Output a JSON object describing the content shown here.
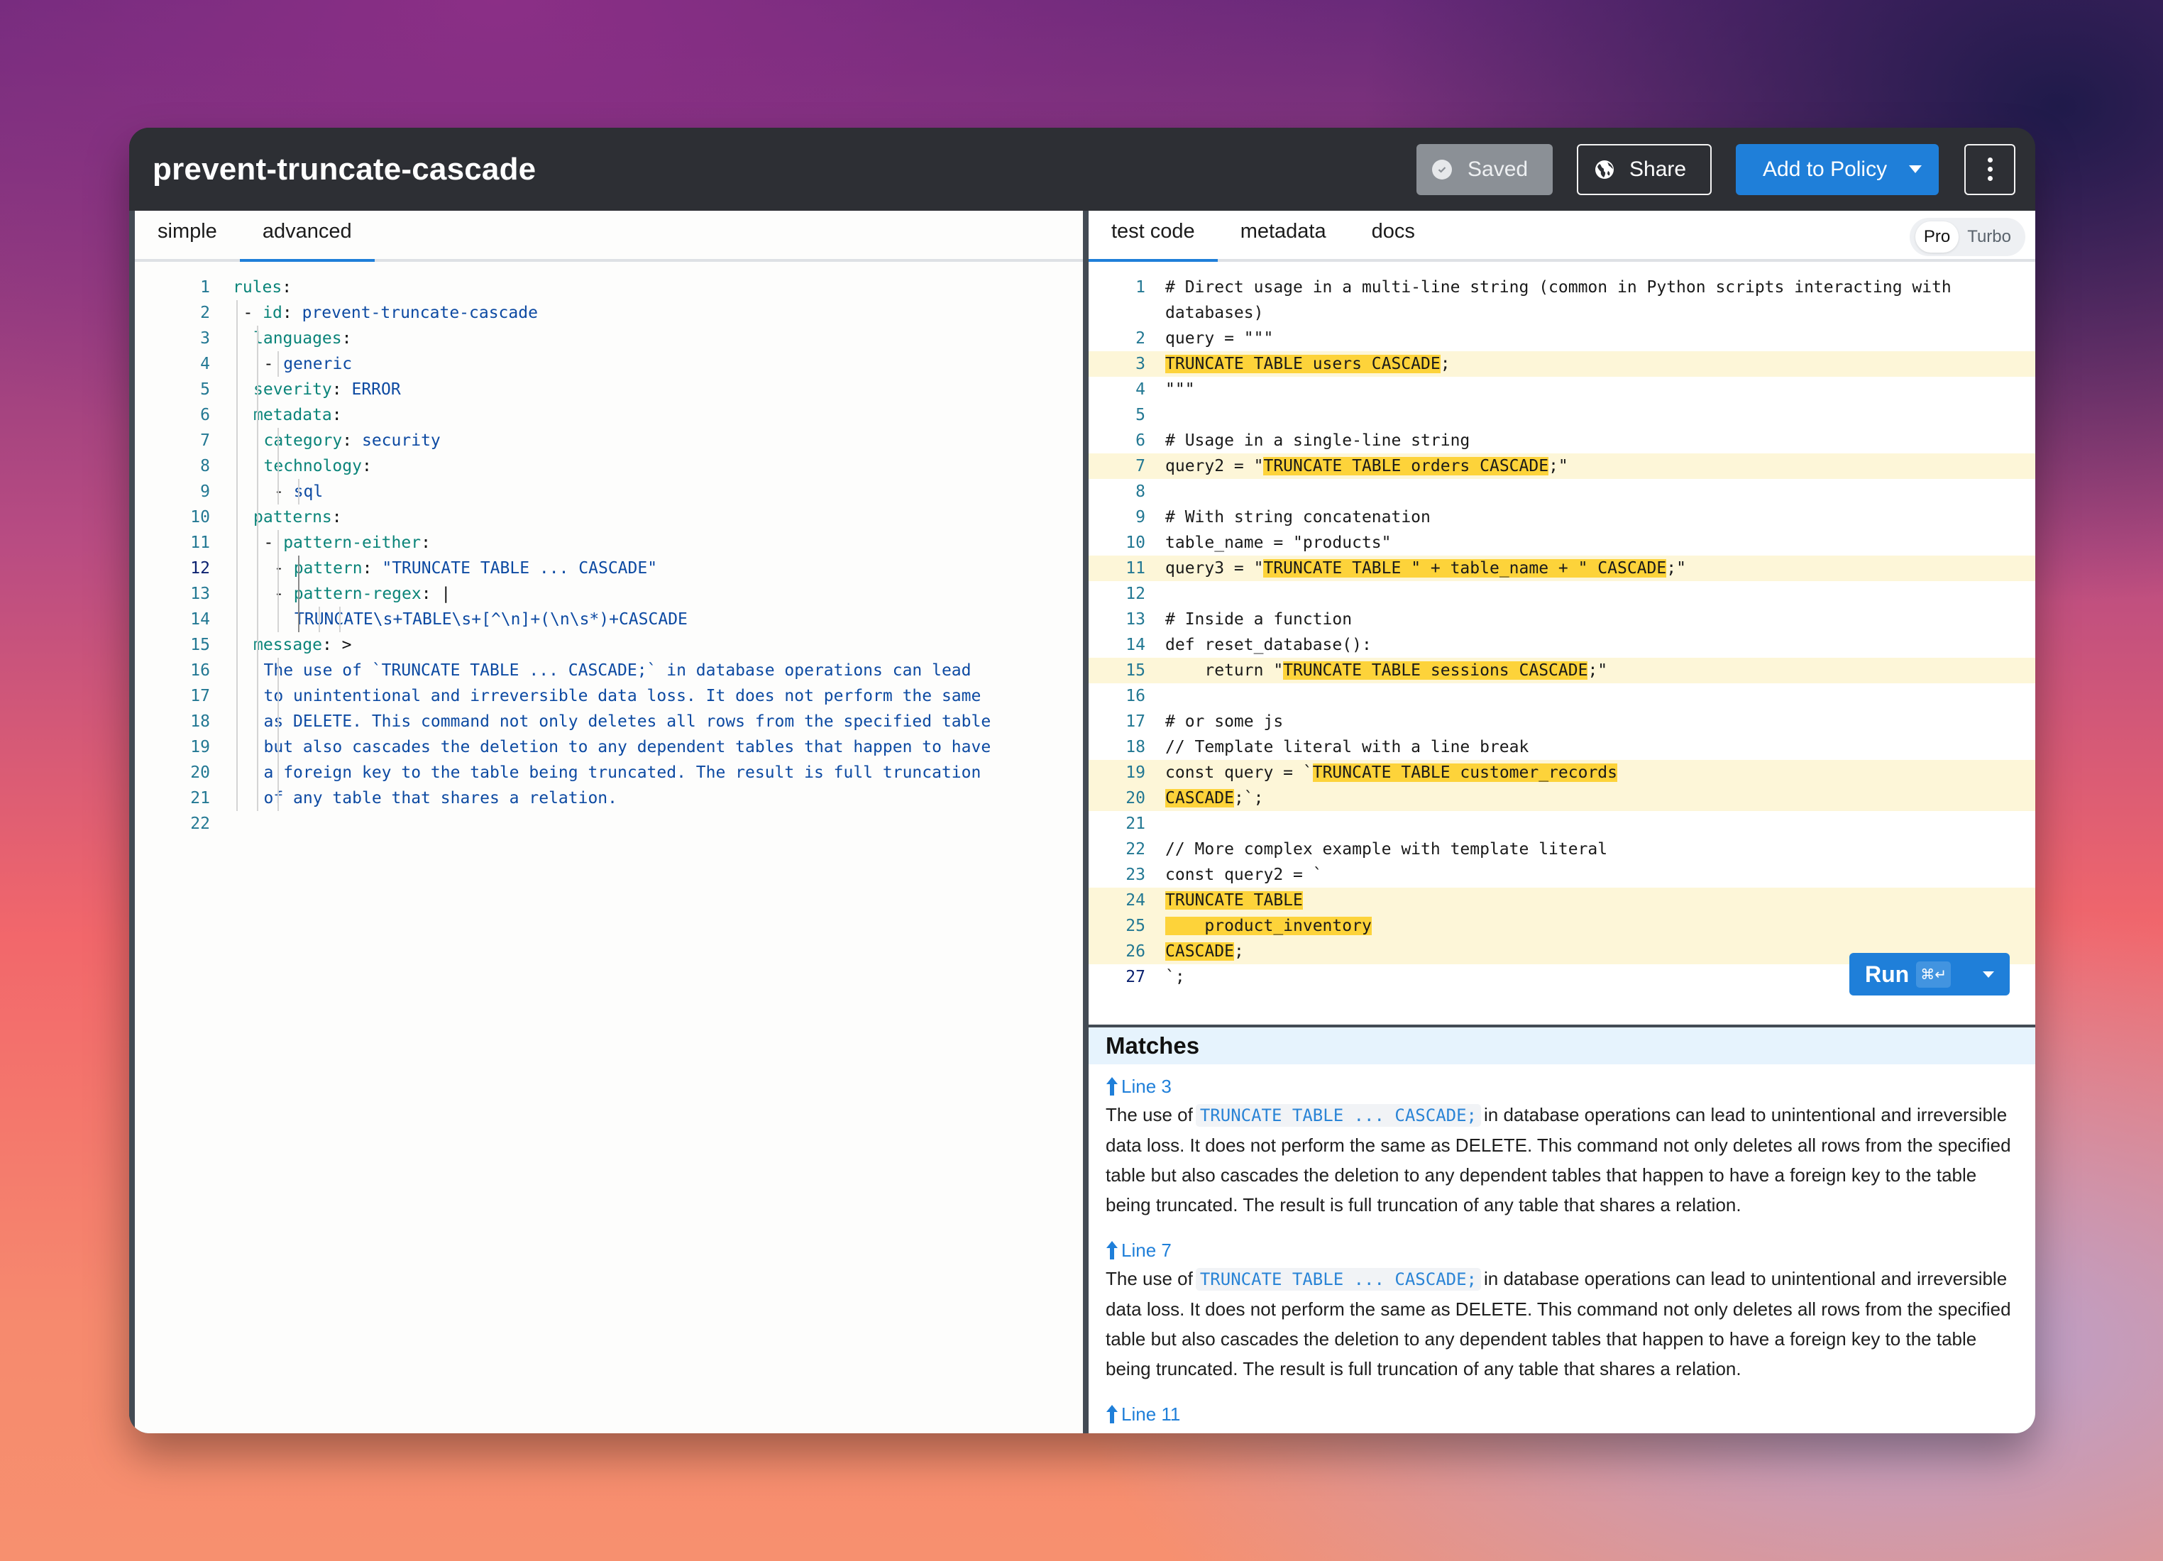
{
  "header": {
    "title": "prevent-truncate-cascade",
    "saved_label": "Saved",
    "share_label": "Share",
    "add_policy_label": "Add to Policy"
  },
  "left_tabs": [
    {
      "label": "simple",
      "active": false
    },
    {
      "label": "advanced",
      "active": true
    }
  ],
  "right_tabs": [
    {
      "label": "test code",
      "active": true
    },
    {
      "label": "metadata",
      "active": false
    },
    {
      "label": "docs",
      "active": false
    }
  ],
  "mode_toggle": {
    "options": [
      "Pro",
      "Turbo"
    ],
    "selected": "Pro"
  },
  "rule_editor": {
    "current_line": 12,
    "lines": [
      {
        "n": 1,
        "indent": 0,
        "parts": [
          [
            "k",
            "rules"
          ],
          [
            "p",
            ":"
          ]
        ]
      },
      {
        "n": 2,
        "indent": 1,
        "parts": [
          [
            "p",
            "- "
          ],
          [
            "k",
            "id"
          ],
          [
            "p",
            ": "
          ],
          [
            "v",
            "prevent-truncate-cascade"
          ]
        ]
      },
      {
        "n": 3,
        "indent": 2,
        "parts": [
          [
            "k",
            "languages"
          ],
          [
            "p",
            ":"
          ]
        ]
      },
      {
        "n": 4,
        "indent": 3,
        "parts": [
          [
            "p",
            "- "
          ],
          [
            "v",
            "generic"
          ]
        ]
      },
      {
        "n": 5,
        "indent": 2,
        "parts": [
          [
            "k",
            "severity"
          ],
          [
            "p",
            ": "
          ],
          [
            "v",
            "ERROR"
          ]
        ]
      },
      {
        "n": 6,
        "indent": 2,
        "parts": [
          [
            "k",
            "metadata"
          ],
          [
            "p",
            ":"
          ]
        ]
      },
      {
        "n": 7,
        "indent": 3,
        "parts": [
          [
            "k",
            "category"
          ],
          [
            "p",
            ": "
          ],
          [
            "v",
            "security"
          ]
        ]
      },
      {
        "n": 8,
        "indent": 3,
        "parts": [
          [
            "k",
            "technology"
          ],
          [
            "p",
            ":"
          ]
        ]
      },
      {
        "n": 9,
        "indent": 4,
        "parts": [
          [
            "p",
            "- "
          ],
          [
            "v",
            "sql"
          ]
        ]
      },
      {
        "n": 10,
        "indent": 2,
        "parts": [
          [
            "k",
            "patterns"
          ],
          [
            "p",
            ":"
          ]
        ]
      },
      {
        "n": 11,
        "indent": 3,
        "parts": [
          [
            "p",
            "- "
          ],
          [
            "k",
            "pattern-either"
          ],
          [
            "p",
            ":"
          ]
        ]
      },
      {
        "n": 12,
        "indent": 4,
        "parts": [
          [
            "p",
            "- "
          ],
          [
            "k",
            "pattern"
          ],
          [
            "p",
            ": "
          ],
          [
            "v",
            "\"TRUNCATE TABLE ... CASCADE\""
          ]
        ]
      },
      {
        "n": 13,
        "indent": 4,
        "parts": [
          [
            "p",
            "- "
          ],
          [
            "k",
            "pattern-regex"
          ],
          [
            "p",
            ": |"
          ]
        ]
      },
      {
        "n": 14,
        "indent": 6,
        "parts": [
          [
            "v",
            "TRUNCATE\\s+TABLE\\s+[^\\n]+(\\n\\s*)+CASCADE"
          ]
        ]
      },
      {
        "n": 15,
        "indent": 2,
        "parts": [
          [
            "k",
            "message"
          ],
          [
            "p",
            ": >"
          ]
        ]
      },
      {
        "n": 16,
        "indent": 3,
        "parts": [
          [
            "v",
            "The use of `TRUNCATE TABLE ... CASCADE;` in database operations can lead"
          ]
        ]
      },
      {
        "n": 17,
        "indent": 3,
        "parts": [
          [
            "v",
            "to unintentional and irreversible data loss. It does not perform the same"
          ]
        ]
      },
      {
        "n": 18,
        "indent": 3,
        "parts": [
          [
            "v",
            "as DELETE. This command not only deletes all rows from the specified table"
          ]
        ]
      },
      {
        "n": 19,
        "indent": 3,
        "parts": [
          [
            "v",
            "but also cascades the deletion to any dependent tables that happen to have"
          ]
        ]
      },
      {
        "n": 20,
        "indent": 3,
        "parts": [
          [
            "v",
            "a foreign key to the table being truncated. The result is full truncation"
          ]
        ]
      },
      {
        "n": 21,
        "indent": 3,
        "parts": [
          [
            "v",
            "of any table that shares a relation."
          ]
        ]
      },
      {
        "n": 22,
        "indent": 0,
        "parts": []
      }
    ]
  },
  "test_code": {
    "current_line": 27,
    "lines": [
      {
        "n": "1",
        "hl": false,
        "parts": [
          [
            "t",
            "# Direct usage in a multi-line string (common in Python scripts interacting with"
          ]
        ]
      },
      {
        "n": "",
        "hl": false,
        "parts": [
          [
            "t",
            "databases)"
          ]
        ]
      },
      {
        "n": "2",
        "hl": false,
        "parts": [
          [
            "t",
            "query = \"\"\""
          ]
        ]
      },
      {
        "n": "3",
        "hl": true,
        "parts": [
          [
            "m",
            "TRUNCATE TABLE users CASCADE"
          ],
          [
            "t",
            ";"
          ]
        ]
      },
      {
        "n": "4",
        "hl": false,
        "parts": [
          [
            "t",
            "\"\"\""
          ]
        ]
      },
      {
        "n": "5",
        "hl": false,
        "parts": []
      },
      {
        "n": "6",
        "hl": false,
        "parts": [
          [
            "t",
            "# Usage in a single-line string"
          ]
        ]
      },
      {
        "n": "7",
        "hl": true,
        "parts": [
          [
            "t",
            "query2 = \""
          ],
          [
            "m",
            "TRUNCATE TABLE orders CASCADE"
          ],
          [
            "t",
            ";\""
          ]
        ]
      },
      {
        "n": "8",
        "hl": false,
        "parts": []
      },
      {
        "n": "9",
        "hl": false,
        "parts": [
          [
            "t",
            "# With string concatenation"
          ]
        ]
      },
      {
        "n": "10",
        "hl": false,
        "parts": [
          [
            "t",
            "table_name = \"products\""
          ]
        ]
      },
      {
        "n": "11",
        "hl": true,
        "parts": [
          [
            "t",
            "query3 = \""
          ],
          [
            "m",
            "TRUNCATE TABLE \" + table_name + \" CASCADE"
          ],
          [
            "t",
            ";\""
          ]
        ]
      },
      {
        "n": "12",
        "hl": false,
        "parts": []
      },
      {
        "n": "13",
        "hl": false,
        "parts": [
          [
            "t",
            "# Inside a function"
          ]
        ]
      },
      {
        "n": "14",
        "hl": false,
        "parts": [
          [
            "t",
            "def reset_database():"
          ]
        ]
      },
      {
        "n": "15",
        "hl": true,
        "parts": [
          [
            "t",
            "    return \""
          ],
          [
            "m",
            "TRUNCATE TABLE sessions CASCADE"
          ],
          [
            "t",
            ";\""
          ]
        ]
      },
      {
        "n": "16",
        "hl": false,
        "parts": []
      },
      {
        "n": "17",
        "hl": false,
        "parts": [
          [
            "t",
            "# or some js"
          ]
        ]
      },
      {
        "n": "18",
        "hl": false,
        "parts": [
          [
            "t",
            "// Template literal with a line break"
          ]
        ]
      },
      {
        "n": "19",
        "hl": true,
        "parts": [
          [
            "t",
            "const query = `"
          ],
          [
            "m",
            "TRUNCATE TABLE customer_records"
          ]
        ]
      },
      {
        "n": "20",
        "hl": true,
        "parts": [
          [
            "m",
            "CASCADE"
          ],
          [
            "t",
            ";`;"
          ]
        ]
      },
      {
        "n": "21",
        "hl": false,
        "parts": []
      },
      {
        "n": "22",
        "hl": false,
        "parts": [
          [
            "t",
            "// More complex example with template literal"
          ]
        ]
      },
      {
        "n": "23",
        "hl": false,
        "parts": [
          [
            "t",
            "const query2 = `"
          ]
        ]
      },
      {
        "n": "24",
        "hl": true,
        "parts": [
          [
            "m",
            "TRUNCATE TABLE"
          ]
        ]
      },
      {
        "n": "25",
        "hl": true,
        "parts": [
          [
            "m",
            "    product_inventory"
          ]
        ]
      },
      {
        "n": "26",
        "hl": true,
        "parts": [
          [
            "m",
            "CASCADE"
          ],
          [
            "t",
            ";"
          ]
        ]
      },
      {
        "n": "27",
        "hl": false,
        "parts": [
          [
            "t",
            "`;"
          ]
        ]
      }
    ]
  },
  "run_button": {
    "label": "Run",
    "shortcut": "⌘↵"
  },
  "matches": {
    "title": "Matches",
    "items": [
      {
        "line_label": "Line 3",
        "msg_before": "The use of",
        "code": "TRUNCATE TABLE ... CASCADE;",
        "msg_after": "in database operations can lead to unintentional and irreversible data loss. It does not perform the same as DELETE. This command not only deletes all rows from the specified table but also cascades the deletion to any dependent tables that happen to have a foreign key to the table being truncated. The result is full truncation of any table that shares a relation."
      },
      {
        "line_label": "Line 7",
        "msg_before": "The use of",
        "code": "TRUNCATE TABLE ... CASCADE;",
        "msg_after": "in database operations can lead to unintentional and irreversible data loss. It does not perform the same as DELETE. This command not only deletes all rows from the specified table but also cascades the deletion to any dependent tables that happen to have a foreign key to the table being truncated. The result is full truncation of any table that shares a relation."
      },
      {
        "line_label": "Line 11",
        "msg_before": "",
        "code": "",
        "msg_after": ""
      }
    ]
  },
  "colors": {
    "accent": "#1f7fd9",
    "titlebar": "#2d2f34",
    "match_highlight": "#fdd33a",
    "match_line": "#fdf6d8",
    "yaml_key": "#0a8479",
    "yaml_value": "#0d4aa2"
  }
}
